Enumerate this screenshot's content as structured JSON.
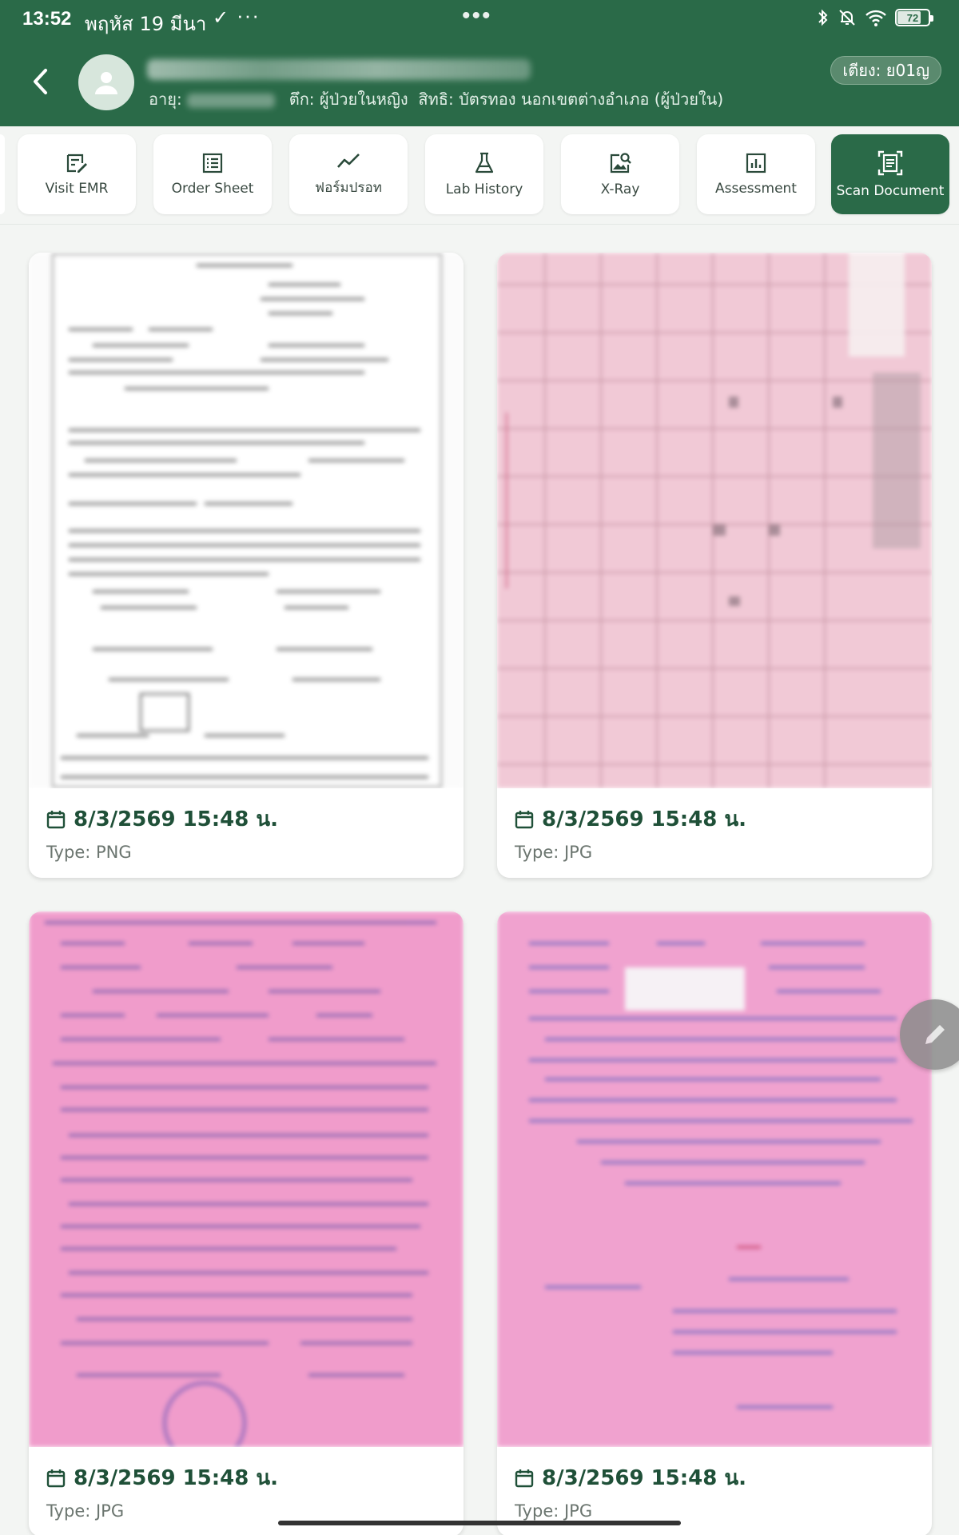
{
  "status_bar": {
    "time": "13:52",
    "date": "พฤหัส 19 มีนา",
    "check_glyph": "✓",
    "more_glyph": "···",
    "center_glyph": "•••",
    "battery": "72",
    "icons": [
      "bluetooth-icon",
      "bell-off-icon",
      "wifi-icon",
      "battery-icon"
    ]
  },
  "patient": {
    "age_label": "อายุ:",
    "ward_label": "ตึก: ผู้ป่วยในหญิง",
    "rights_label": "สิทธิ: บัตรทอง นอกเขตต่างอำเภอ (ผู้ป่วยใน)",
    "bed": "เตียง: ย01ญ"
  },
  "tabs": [
    {
      "label": "Visit EMR",
      "icon": "edit-note-icon"
    },
    {
      "label": "Order Sheet",
      "icon": "list-icon"
    },
    {
      "label": "ฟอร์มปรอท",
      "icon": "trend-line-icon"
    },
    {
      "label": "Lab History",
      "icon": "flask-icon"
    },
    {
      "label": "X-Ray",
      "icon": "image-search-icon"
    },
    {
      "label": "Assessment",
      "icon": "bar-chart-icon"
    },
    {
      "label": "Scan Document",
      "icon": "document-scan-icon",
      "active": true
    }
  ],
  "documents": [
    {
      "date": "8/3/2569 15:48 น.",
      "type": "Type: PNG"
    },
    {
      "date": "8/3/2569 15:48 น.",
      "type": "Type: JPG"
    },
    {
      "date": "8/3/2569 15:48 น.",
      "type": "Type: JPG"
    },
    {
      "date": "8/3/2569 15:48 น.",
      "type": "Type: JPG"
    }
  ],
  "colors": {
    "brand": "#2a6a48",
    "background": "#f3f5f3",
    "pink_scan": "#f2a3cf"
  }
}
